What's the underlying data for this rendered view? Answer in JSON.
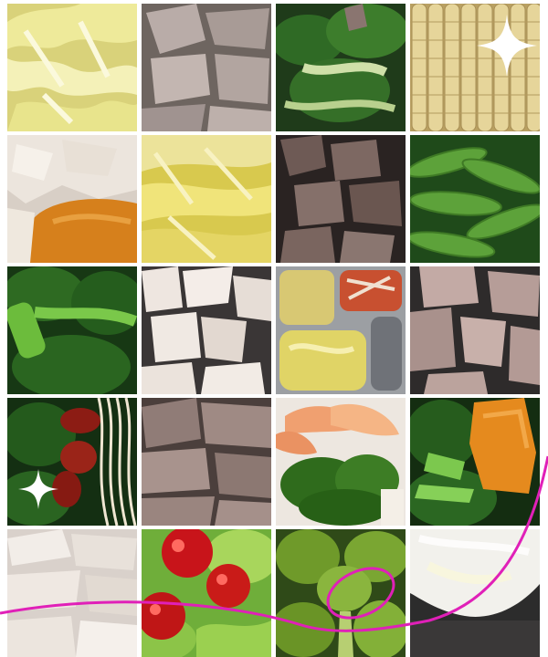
{
  "photo_grid": {
    "columns": 4,
    "rows": 5,
    "tiles": [
      {
        "subject": "napa-cabbage"
      },
      {
        "subject": "sliced-pork"
      },
      {
        "subject": "bok-choy"
      },
      {
        "subject": "corn-kernels"
      },
      {
        "subject": "chicken-and-pumpkin"
      },
      {
        "subject": "napa-cabbage"
      },
      {
        "subject": "beef-chunks"
      },
      {
        "subject": "snow-peas"
      },
      {
        "subject": "leafy-greens-and-stalks"
      },
      {
        "subject": "chicken-chunks"
      },
      {
        "subject": "divided-tray"
      },
      {
        "subject": "pork-chunks"
      },
      {
        "subject": "greens-dates-noodles"
      },
      {
        "subject": "sliced-beef"
      },
      {
        "subject": "shrimp-and-broccoli"
      },
      {
        "subject": "greens-and-pumpkin"
      },
      {
        "subject": "shredded-chicken"
      },
      {
        "subject": "tomatoes-and-lettuce"
      },
      {
        "subject": "broccoli"
      },
      {
        "subject": "tofu-slice"
      }
    ]
  },
  "decorations": {
    "sparkle_count": 2,
    "sparkle_color": "#ffffff",
    "annotation_color": "#e020b8"
  }
}
